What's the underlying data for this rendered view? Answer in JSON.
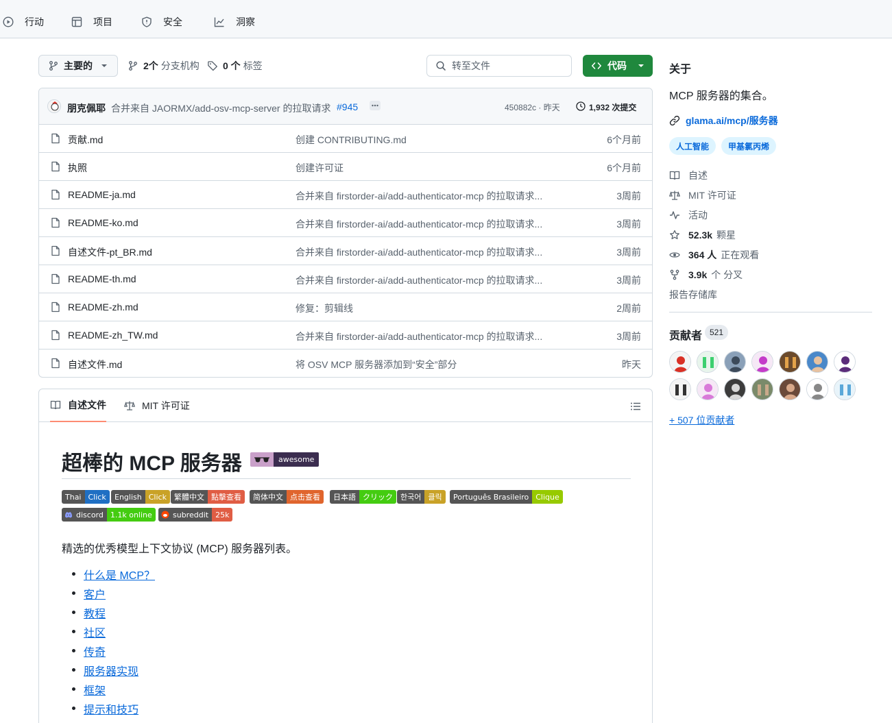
{
  "topnav": {
    "items": [
      {
        "label": "行动",
        "icon": "play-icon"
      },
      {
        "label": "项目",
        "icon": "table-icon"
      },
      {
        "label": "安全",
        "icon": "shield-icon"
      },
      {
        "label": "洞察",
        "icon": "graph-icon"
      }
    ]
  },
  "branchbar": {
    "branch": "主要的",
    "branches_count": "2个",
    "branches_label": "分支机构",
    "tags_count": "0 个",
    "tags_label": "标签",
    "search_placeholder": "转至文件",
    "code_label": "代码"
  },
  "commit": {
    "author": "朋克佩耶",
    "message": "合并来自 JAORMX/add-osv-mcp-server 的拉取请求",
    "pr": "#945",
    "hash_time": "450882c · 昨天",
    "commits": "1,932 次提交"
  },
  "files": [
    {
      "name": "贡献.md",
      "message": "创建 CONTRIBUTING.md",
      "age": "6个月前"
    },
    {
      "name": "执照",
      "message": "创建许可证",
      "age": "6个月前"
    },
    {
      "name": "README-ja.md",
      "message": "合并来自 firstorder-ai/add-authenticator-mcp 的拉取请求...",
      "age": "3周前"
    },
    {
      "name": "README-ko.md",
      "message": "合并来自 firstorder-ai/add-authenticator-mcp 的拉取请求...",
      "age": "3周前"
    },
    {
      "name": "自述文件-pt_BR.md",
      "message": "合并来自 firstorder-ai/add-authenticator-mcp 的拉取请求...",
      "age": "3周前"
    },
    {
      "name": "README-th.md",
      "message": "合并来自 firstorder-ai/add-authenticator-mcp 的拉取请求...",
      "age": "3周前"
    },
    {
      "name": "README-zh.md",
      "message": "修复：剪辑线",
      "age": "2周前"
    },
    {
      "name": "README-zh_TW.md",
      "message": "合并来自 firstorder-ai/add-authenticator-mcp 的拉取请求...",
      "age": "3周前"
    },
    {
      "name": "自述文件.md",
      "message": "将 OSV MCP 服务器添加到“安全”部分",
      "age": "昨天"
    }
  ],
  "readme": {
    "tab_readme": "自述文件",
    "tab_license": "MIT 许可证",
    "title": "超棒的 MCP 服务器",
    "awesome_badge": "awesome",
    "badges": [
      {
        "left": "Thai",
        "right": "Click",
        "color": "#1f6fc3"
      },
      {
        "left": "English",
        "right": "Click",
        "color": "#c9a227"
      },
      {
        "left": "繁體中文",
        "right": "點擊查看",
        "color": "#e05d44"
      },
      {
        "left": "简体中文",
        "right": "点击查看",
        "color": "#e0652d"
      },
      {
        "left": "日本語",
        "right": "クリック",
        "color": "#4c1"
      },
      {
        "left": "한국어",
        "right": "클릭",
        "color": "#c9a227"
      },
      {
        "left": "Português Brasileiro",
        "right": "Clique",
        "color": "#97ca00"
      }
    ],
    "badges2": [
      {
        "left": "discord",
        "right": "1.1k online",
        "color": "#44cc11"
      },
      {
        "left": "subreddit",
        "right": "25k",
        "color": "#e05d44"
      }
    ],
    "intro": "精选的优秀模型上下文协议 (MCP) 服务器列表。",
    "toc": [
      "什么是 MCP？",
      "客户",
      "教程",
      "社区",
      "传奇",
      "服务器实现",
      "框架",
      "提示和技巧"
    ]
  },
  "about": {
    "heading": "关于",
    "description": "MCP 服务器的集合。",
    "link": "glama.ai/mcp/服务器",
    "topics": [
      "人工智能",
      "甲基氯丙烯"
    ],
    "readme": "自述",
    "license": "MIT 许可证",
    "activity": "活动",
    "stars_count": "52.3k",
    "stars_label": "颗星",
    "watching_count": "364 人",
    "watching_label": "正在观看",
    "forks_count": "3.9k",
    "forks_label": "个 分叉",
    "report": "报告存储库"
  },
  "contributors": {
    "heading": "贡献者",
    "count": "521",
    "more": "+ 507 位贡献者"
  }
}
